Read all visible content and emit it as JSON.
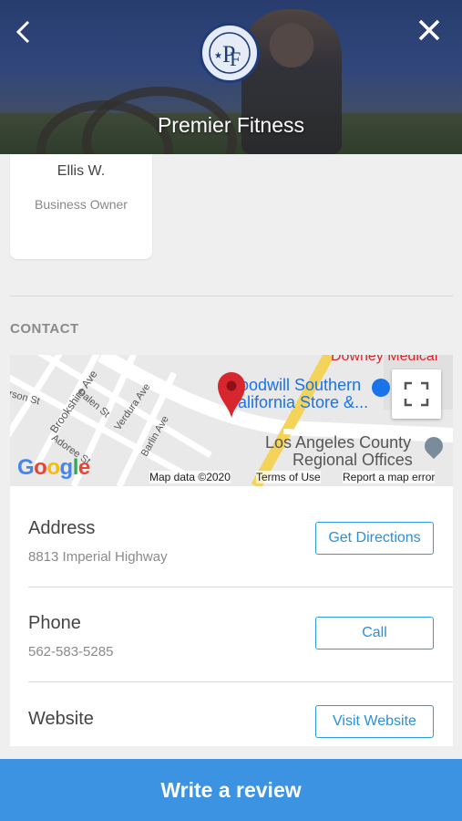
{
  "header": {
    "title": "Premier Fitness",
    "back_icon": "chevron-left-icon",
    "close_icon": "close-icon",
    "logo_initials": "PF",
    "logo_ring_text": "PREMIER FITNESS"
  },
  "owner": {
    "name": "Ellis W.",
    "role": "Business Owner"
  },
  "contact": {
    "section_title": "CONTACT",
    "map": {
      "streets": [
        "Brookshire Ave",
        "Dalen St",
        "Verdura Ave",
        "Adoree St",
        "Barlin Ave",
        "rson St"
      ],
      "poi_goodwill": [
        "oodwill Southern",
        "alifornia Store &..."
      ],
      "poi_downey": "Downey Medical",
      "poi_la_county": [
        "Los Angeles County",
        "Regional Offices"
      ],
      "google_logo": [
        "G",
        "o",
        "o",
        "g",
        "l",
        "e"
      ],
      "footer": {
        "map_data": "Map data ©2020",
        "terms": "Terms of Use",
        "report": "Report a map error"
      }
    },
    "rows": [
      {
        "label": "Address",
        "value": "8813 Imperial Highway",
        "button": "Get Directions"
      },
      {
        "label": "Phone",
        "value": "562-583-5285",
        "button": "Call"
      },
      {
        "label": "Website",
        "value": "",
        "button": "Visit Website"
      }
    ]
  },
  "footer": {
    "review_button": "Write a review"
  },
  "colors": {
    "accent": "#3b93e2",
    "button_border": "#2b9be0",
    "pin": "#d8262f"
  }
}
